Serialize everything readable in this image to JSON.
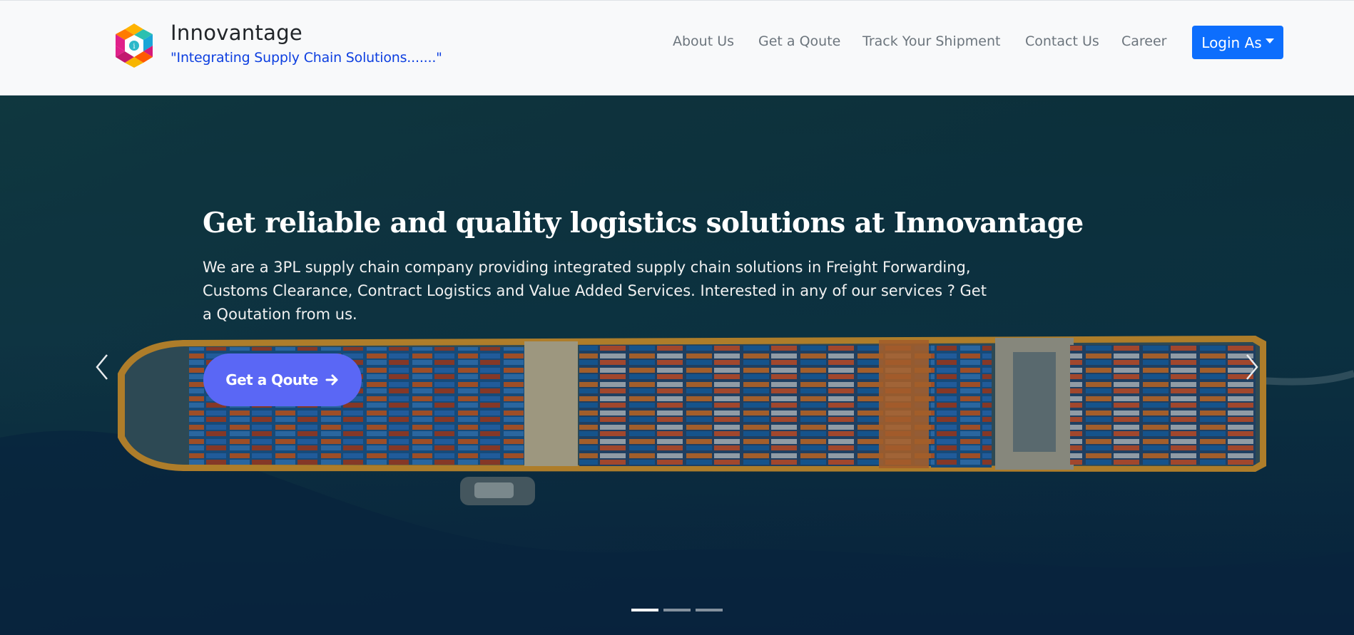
{
  "brand": {
    "name": "Innovantage",
    "tagline": "\"Integrating Supply Chain Solutions.......\""
  },
  "nav": {
    "links": [
      "About Us",
      "Get a Qoute",
      "Track Your Shipment",
      "Contact Us",
      "Career"
    ],
    "login_label": "Login As"
  },
  "hero": {
    "title": "Get reliable and quality logistics solutions at Innovantage",
    "description": "We are a 3PL supply chain company providing integrated supply chain solutions in Freight Forwarding, Customs Clearance, Contract Logistics and Value Added Services. Interested in any of our services ? Get a Qoutation from us.",
    "cta_label": "Get a Qoute",
    "slides": 3,
    "active_slide": 1
  },
  "colors": {
    "primary": "#0d6efd",
    "cta": "#5a67f5",
    "tagline": "#0d3fe0",
    "navbar_bg": "#f8f9fa"
  },
  "icons": [
    "innovantage-logo",
    "arrow-right-icon",
    "chevron-left-icon",
    "chevron-right-icon",
    "caret-down-icon"
  ]
}
